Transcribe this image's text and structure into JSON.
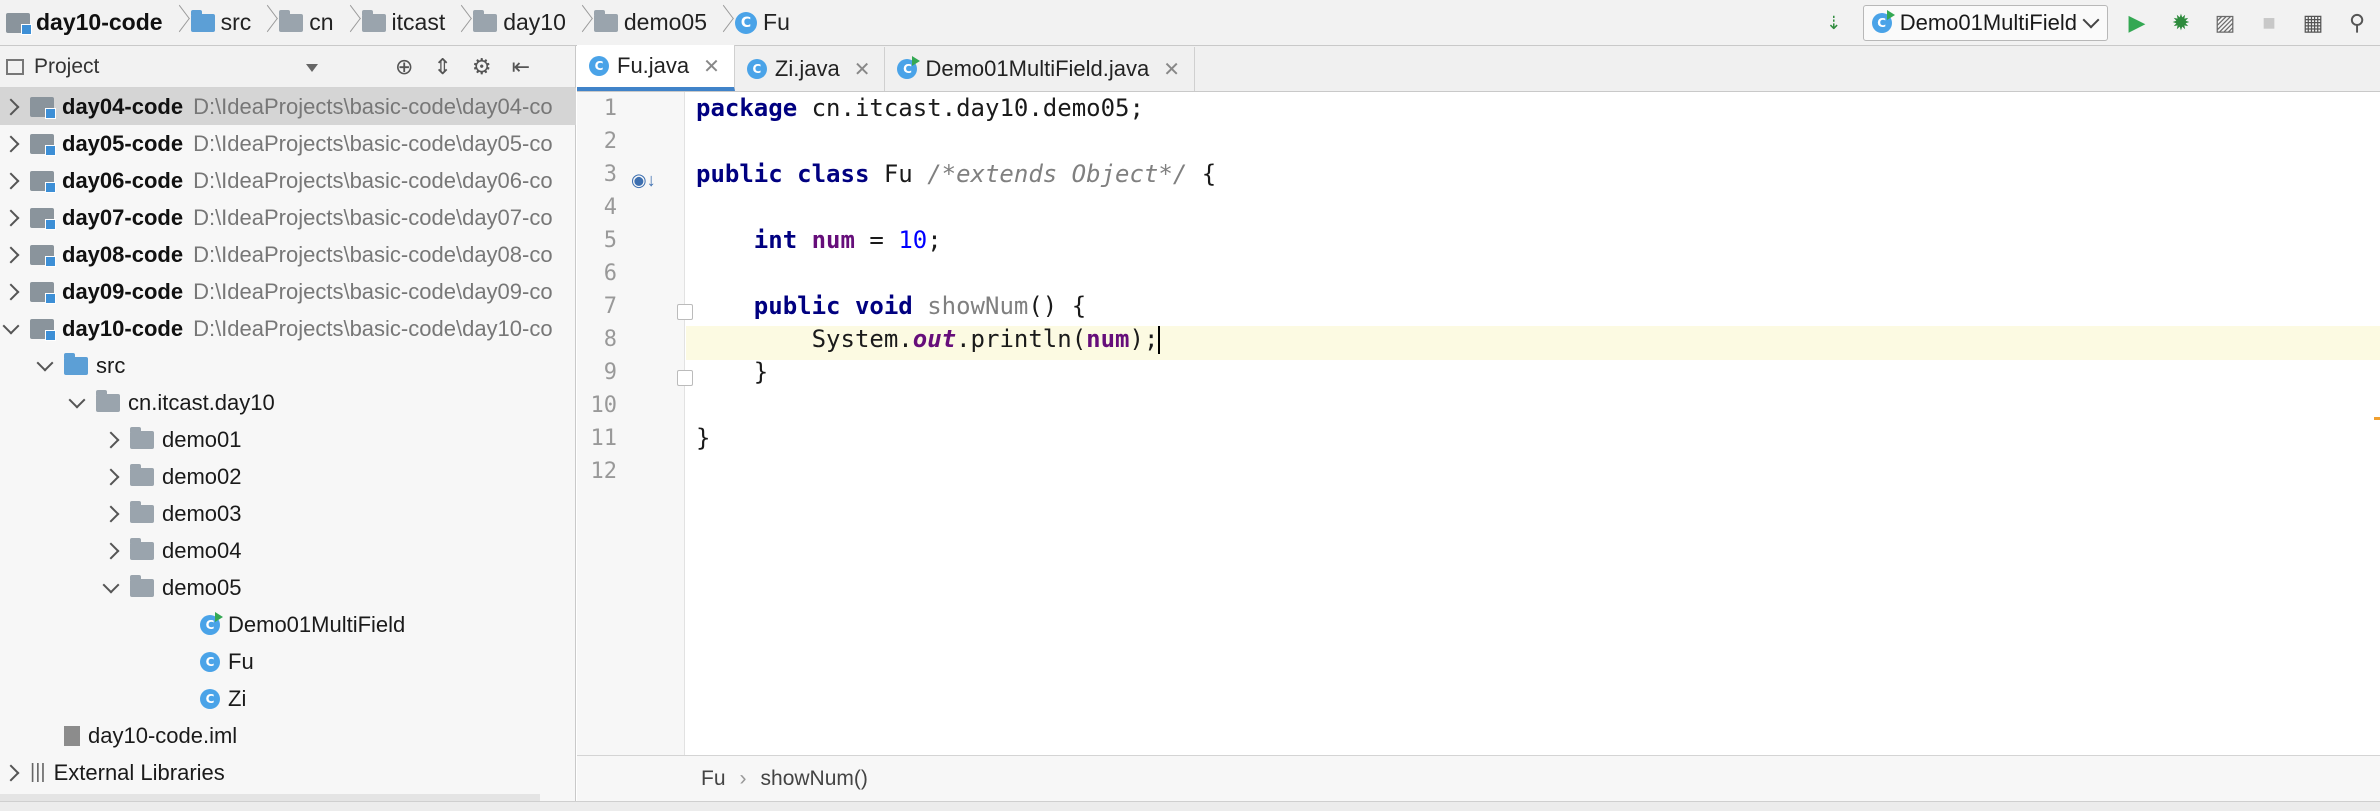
{
  "navbar": {
    "breadcrumbs": [
      {
        "label": "day10-code",
        "icon": "module-icon"
      },
      {
        "label": "src",
        "icon": "source-folder-icon"
      },
      {
        "label": "cn",
        "icon": "package-icon"
      },
      {
        "label": "itcast",
        "icon": "package-icon"
      },
      {
        "label": "day10",
        "icon": "package-icon"
      },
      {
        "label": "demo05",
        "icon": "package-icon"
      },
      {
        "label": "Fu",
        "icon": "class-icon"
      }
    ],
    "run_config": "Demo01MultiField",
    "colors": {
      "run": "#34a853",
      "debug": "#2e8b3d"
    }
  },
  "project": {
    "title": "Project",
    "tree": [
      {
        "name": "day04-code",
        "path": "D:\\IdeaProjects\\basic-code\\day04-co",
        "level": 0,
        "type": "module",
        "expanded": false,
        "selected": true
      },
      {
        "name": "day05-code",
        "path": "D:\\IdeaProjects\\basic-code\\day05-co",
        "level": 0,
        "type": "module",
        "expanded": false
      },
      {
        "name": "day06-code",
        "path": "D:\\IdeaProjects\\basic-code\\day06-co",
        "level": 0,
        "type": "module",
        "expanded": false
      },
      {
        "name": "day07-code",
        "path": "D:\\IdeaProjects\\basic-code\\day07-co",
        "level": 0,
        "type": "module",
        "expanded": false
      },
      {
        "name": "day08-code",
        "path": "D:\\IdeaProjects\\basic-code\\day08-co",
        "level": 0,
        "type": "module",
        "expanded": false
      },
      {
        "name": "day09-code",
        "path": "D:\\IdeaProjects\\basic-code\\day09-co",
        "level": 0,
        "type": "module",
        "expanded": false
      },
      {
        "name": "day10-code",
        "path": "D:\\IdeaProjects\\basic-code\\day10-co",
        "level": 0,
        "type": "module",
        "expanded": true
      },
      {
        "name": "src",
        "level": 1,
        "type": "source-folder",
        "expanded": true
      },
      {
        "name": "cn.itcast.day10",
        "level": 2,
        "type": "package",
        "expanded": true
      },
      {
        "name": "demo01",
        "level": 3,
        "type": "package",
        "expanded": false
      },
      {
        "name": "demo02",
        "level": 3,
        "type": "package",
        "expanded": false
      },
      {
        "name": "demo03",
        "level": 3,
        "type": "package",
        "expanded": false
      },
      {
        "name": "demo04",
        "level": 3,
        "type": "package",
        "expanded": false
      },
      {
        "name": "demo05",
        "level": 3,
        "type": "package",
        "expanded": true
      },
      {
        "name": "Demo01MultiField",
        "level": 4,
        "type": "class-main"
      },
      {
        "name": "Fu",
        "level": 4,
        "type": "class"
      },
      {
        "name": "Zi",
        "level": 4,
        "type": "class"
      },
      {
        "name": "day10-code.iml",
        "level": 1,
        "type": "iml"
      },
      {
        "name": "External Libraries",
        "level": 0,
        "type": "libraries",
        "expanded": false
      }
    ]
  },
  "tabs": [
    {
      "label": "Fu.java",
      "active": true
    },
    {
      "label": "Zi.java",
      "active": false
    },
    {
      "label": "Demo01MultiField.java",
      "active": false,
      "runnable": true
    }
  ],
  "editor": {
    "line_numbers": [
      "1",
      "2",
      "3",
      "4",
      "5",
      "6",
      "7",
      "8",
      "9",
      "10",
      "11",
      "12"
    ],
    "line1": {
      "kw": "package",
      "rest": " cn.itcast.day10.demo05;"
    },
    "line3": {
      "kw": "public class",
      "name": " Fu ",
      "comment": "/*extends Object*/",
      "brace": " {"
    },
    "line5": {
      "kw": "int",
      "field": "num",
      "eq": " = ",
      "num": "10",
      "semi": ";"
    },
    "line7": {
      "kw": "public void",
      "method": "showNum",
      "rest": "() {"
    },
    "line8": {
      "pre": "System.",
      "out": "out",
      "mid": ".println(",
      "arg": "num",
      "post": ");"
    },
    "line9": "}",
    "line11": "}"
  },
  "editor_breadcrumb": {
    "class": "Fu",
    "method": "showNum()"
  }
}
